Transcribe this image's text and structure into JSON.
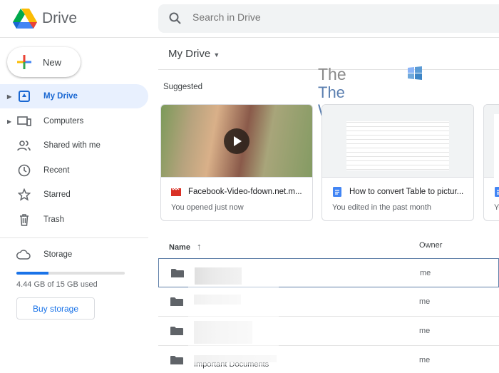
{
  "app": {
    "name": "Drive"
  },
  "search": {
    "placeholder": "Search in Drive"
  },
  "sidebar": {
    "new_label": "New",
    "items": [
      {
        "label": "My Drive"
      },
      {
        "label": "Computers"
      },
      {
        "label": "Shared with me"
      },
      {
        "label": "Recent"
      },
      {
        "label": "Starred"
      },
      {
        "label": "Trash"
      }
    ],
    "storage": {
      "label": "Storage",
      "used_text": "4.44 GB of 15 GB used",
      "used_fraction": 0.296,
      "buy_label": "Buy storage"
    }
  },
  "main": {
    "title": "My Drive",
    "watermark": "The WindowsClub",
    "suggested_label": "Suggested",
    "cards": [
      {
        "name": "Facebook-Video-fdown.net.m...",
        "sub": "You opened just now"
      },
      {
        "name": "How to convert Table to pictur...",
        "sub": "You edited in the past month"
      },
      {
        "name": "",
        "sub": "Yo"
      }
    ],
    "columns": {
      "name": "Name",
      "owner": "Owner"
    },
    "rows": [
      {
        "name": "",
        "owner": "me"
      },
      {
        "name": "",
        "owner": "me"
      },
      {
        "name": "",
        "owner": "me"
      },
      {
        "name": "Important Documents",
        "owner": "me"
      }
    ]
  },
  "colors": {
    "accent": "#1a73e8",
    "active_bg": "#e8f0fe"
  }
}
